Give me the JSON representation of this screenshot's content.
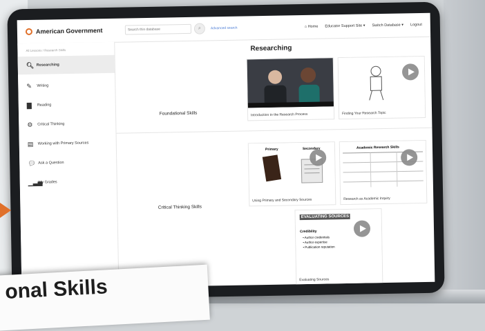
{
  "header": {
    "app_title": "American Government",
    "search_placeholder": "Search this database",
    "advanced_search": "Advanced search",
    "home": "Home",
    "educator_support": "Educator Support Site",
    "switch_database": "Switch Database",
    "logout": "Logout"
  },
  "sidebar": {
    "breadcrumb": "All Lessons / Research Skills",
    "items": [
      {
        "label": "Researching",
        "icon": "search-icon",
        "active": true
      },
      {
        "label": "Writing",
        "icon": "edit-icon",
        "active": false
      },
      {
        "label": "Reading",
        "icon": "book-icon",
        "active": false
      },
      {
        "label": "Critical Thinking",
        "icon": "gears-icon",
        "active": false
      },
      {
        "label": "Working with Primary Sources",
        "icon": "document-icon",
        "active": false
      },
      {
        "label": "Ask a Question",
        "icon": "chat-icon",
        "active": false
      },
      {
        "label": "My Grades",
        "icon": "bar-chart-icon",
        "active": false
      }
    ]
  },
  "main": {
    "section_title": "Researching",
    "rows": [
      {
        "label": "Foundational Skills",
        "cards": [
          {
            "caption": "Introduction to the Research Process"
          },
          {
            "caption": "Finding Your Research Topic"
          }
        ]
      },
      {
        "label": "Critical Thinking Skills",
        "cards": [
          {
            "caption": "Using Primary and Secondary Sources"
          },
          {
            "caption": "Research as Academic Inquiry"
          },
          {
            "caption": "Evaluating Sources"
          }
        ]
      }
    ],
    "thumb_texts": {
      "primary": "Primary",
      "secondary": "Secondary",
      "table_title": "Academic Research Skills",
      "eval_title": "EVALUATING SOURCES",
      "credibility": "Credibility",
      "bullets": [
        "Author credentials",
        "Author expertise",
        "Publication reputation"
      ]
    }
  },
  "overlay": {
    "paper_text": "onal Skills"
  },
  "colors": {
    "accent": "#e0702a",
    "link": "#4f7fd6"
  }
}
